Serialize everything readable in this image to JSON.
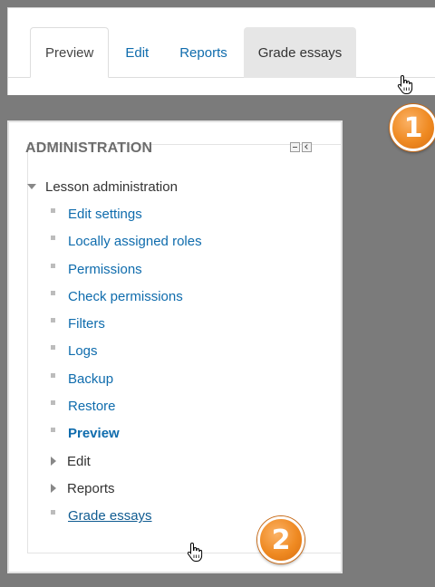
{
  "tabs": [
    {
      "label": "Preview",
      "state": "active"
    },
    {
      "label": "Edit",
      "state": "normal"
    },
    {
      "label": "Reports",
      "state": "normal"
    },
    {
      "label": "Grade essays",
      "state": "hovered"
    }
  ],
  "administration": {
    "title": "ADMINISTRATION",
    "controls": [
      "minimize-icon",
      "dock-icon"
    ],
    "section_label": "Lesson administration",
    "items": [
      {
        "label": "Edit settings",
        "style": "link"
      },
      {
        "label": "Locally assigned roles",
        "style": "link"
      },
      {
        "label": "Permissions",
        "style": "link"
      },
      {
        "label": "Check permissions",
        "style": "link"
      },
      {
        "label": "Filters",
        "style": "link"
      },
      {
        "label": "Logs",
        "style": "link"
      },
      {
        "label": "Backup",
        "style": "link"
      },
      {
        "label": "Restore",
        "style": "link"
      },
      {
        "label": "Preview",
        "style": "bold-link"
      },
      {
        "label": "Edit",
        "style": "collapsed"
      },
      {
        "label": "Reports",
        "style": "collapsed"
      },
      {
        "label": "Grade essays",
        "style": "underlined"
      }
    ]
  },
  "badges": {
    "step1": "1",
    "step2": "2"
  },
  "colors": {
    "link": "#0f6cad",
    "badge": "#ef8a22",
    "backdrop": "#7b7b7b"
  }
}
